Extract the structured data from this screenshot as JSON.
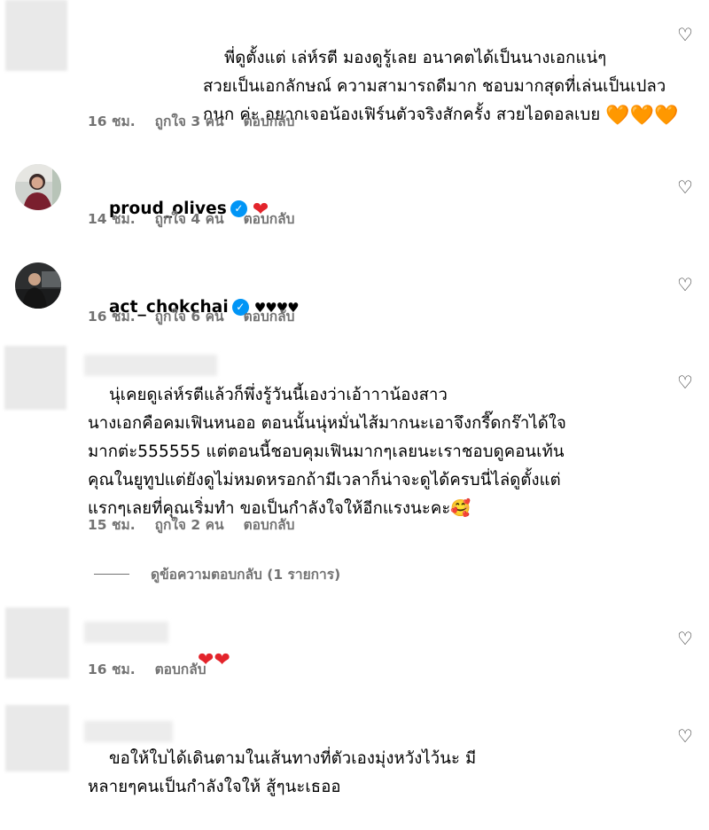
{
  "comments": [
    {
      "text": "พี่ดูตั้งแต่ เล่ห์รตี มองดูรู้เลย อนาคตได้เป็นนางเอกแน่ๆ\nสวยเป็นเอกลักษณ์ ความสามารถดีมาก ชอบมากสุดที่เล่นเป็นเปลว\nกนก ค่ะ อยากเจอน้องเฟิร์นตัวจริงสักครั้ง สวยไอดอลเบย",
      "emojis": "🧡🧡🧡",
      "time": "16 ชม.",
      "likes": "ถูกใจ 3 คน",
      "reply": "ตอบกลับ"
    },
    {
      "username": "proud_olives",
      "verified": true,
      "text": "❤",
      "time": "14 ชม.",
      "likes": "ถูกใจ 4 คน",
      "reply": "ตอบกลับ"
    },
    {
      "username": "act_chokchai",
      "verified": true,
      "text": "♥♥♥♥",
      "time": "16 ชม.",
      "likes": "ถูกใจ 6 คน",
      "reply": "ตอบกลับ"
    },
    {
      "text": "นุ่เคยดูเล่ห์รตีแล้วก็พึ่งรู้วันนี้เองว่าเอ้าาาน้องสาว\nนางเอกคือคมเฟินหนออ ตอนนั้นนุ่หมั่นไส้มากนะเอาจึงกรี๊ดกร๊าได้ใจ\nมากต่ะ555555 แต่ตอนนี้ชอบคุมเฟินมากๆเลยนะเราชอบดูคอนเท้น\nคุณในยูทูปแต่ยังดูไม่หมดหรอกถ้ามีเวลาก็น่าจะดูได้ครบนี่ไล่ดูตั้งแต่\nแรกๆเลยที่คุณเริ่มทำ ขอเป็นกำลังใจให้อีกแรงนะคะ🥰",
      "time": "15 ชม.",
      "likes": "ถูกใจ 2 คน",
      "reply": "ตอบกลับ",
      "view_replies": "ดูข้อความตอบกลับ (1 รายการ)"
    },
    {
      "text": "❤❤",
      "time": "16 ชม.",
      "reply": "ตอบกลับ"
    },
    {
      "text": "ขอให้ใบได้เดินตามในเส้นทางที่ตัวเองมุ่งหวังไว้นะ มี\nหลายๆคนเป็นกำลังใจให้ สู้ๆนะเธออ"
    }
  ],
  "icons": {
    "like": "heart-outline-icon",
    "verified": "verified-badge-icon"
  },
  "colors": {
    "meta_text": "#737373",
    "verified": "#0095f6",
    "orange_heart": "#f77f00",
    "red_heart": "#e3242b"
  }
}
